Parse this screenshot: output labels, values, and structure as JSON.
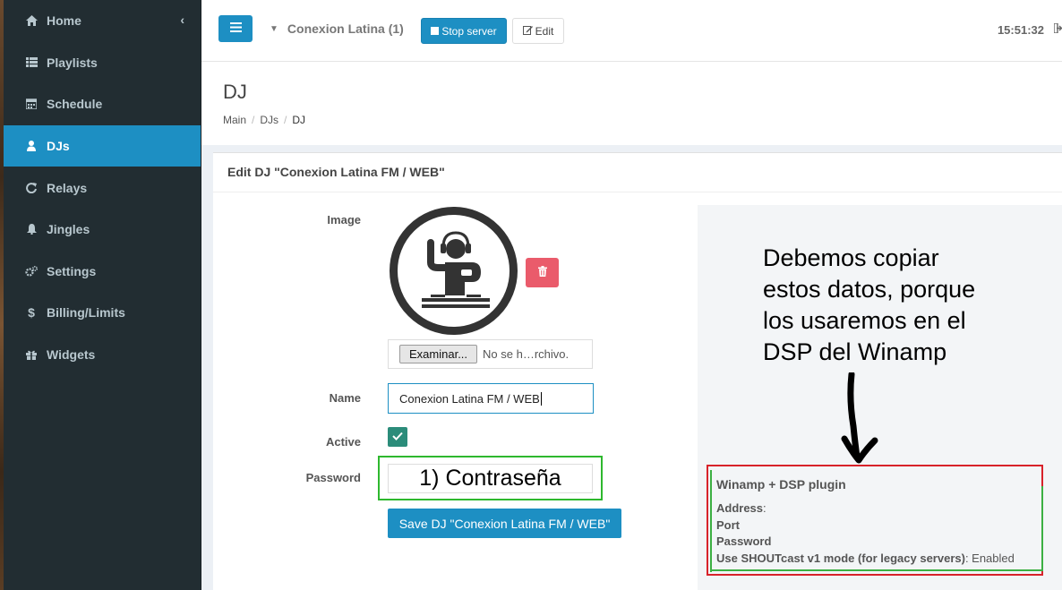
{
  "sidebar": {
    "items": [
      {
        "label": "Home",
        "icon": "home-icon"
      },
      {
        "label": "Playlists",
        "icon": "list-icon"
      },
      {
        "label": "Schedule",
        "icon": "calendar-icon"
      },
      {
        "label": "DJs",
        "icon": "user-icon",
        "active": true
      },
      {
        "label": "Relays",
        "icon": "refresh-icon"
      },
      {
        "label": "Jingles",
        "icon": "bell-icon"
      },
      {
        "label": "Settings",
        "icon": "gears-icon"
      },
      {
        "label": "Billing/Limits",
        "icon": "dollar-icon"
      },
      {
        "label": "Widgets",
        "icon": "gift-icon"
      }
    ],
    "collapse_glyph": "‹"
  },
  "topbar": {
    "server_name": "Conexion Latina (1)",
    "stop_label": "Stop server",
    "edit_label": "Edit",
    "clock": "15:51:32"
  },
  "header": {
    "title": "DJ",
    "breadcrumb": [
      "Main",
      "DJs",
      "DJ"
    ]
  },
  "form": {
    "box_title": "Edit DJ \"Conexion Latina FM / WEB\"",
    "image_label": "Image",
    "file_button": "Examinar...",
    "file_status": "No se h…rchivo.",
    "name_label": "Name",
    "name_value": "Conexion Latina FM / WEB",
    "active_label": "Active",
    "active_checked": true,
    "password_label": "Password",
    "password_value": "1) Contraseña",
    "save_label": "Save DJ \"Conexion Latina FM / WEB\""
  },
  "annotation": {
    "lines": [
      "Debemos copiar",
      "estos datos, porque",
      "los usaremos en el",
      "DSP del Winamp"
    ]
  },
  "winamp": {
    "title": "Winamp + DSP plugin",
    "address_label": "Address",
    "address_suffix": ":",
    "port_label": "Port",
    "password_label": "Password",
    "shoutcast_label": "Use SHOUTcast v1 mode (for legacy servers)",
    "shoutcast_value": ": Enabled"
  },
  "colors": {
    "sidebar_bg": "#222d32",
    "accent": "#1d8fc3",
    "delete": "#ea5b6b",
    "checkbox": "#2b8c7a",
    "highlight_green": "#2eb82e",
    "highlight_red": "#d8222a"
  }
}
